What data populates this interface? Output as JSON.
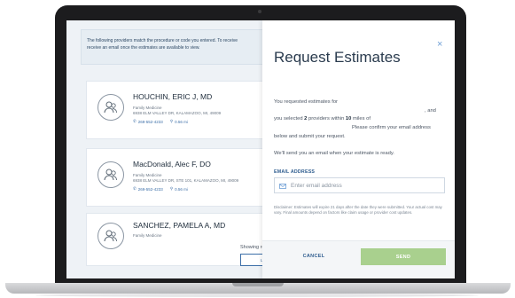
{
  "notice": {
    "line1": "The following providers match the procedure or code you entered. To receive",
    "line2": "receive an email once the estimates are available to view."
  },
  "providers": [
    {
      "name": "HOUCHIN, ERIC J, MD",
      "specialty": "Family Medicine",
      "address": "6938 ELM VALLEY DR, KALAMAZOO, MI, 49009",
      "phone": "269-552-4233",
      "distance": "0.56 mi"
    },
    {
      "name": "MacDonald, Alec F, DO",
      "specialty": "Family Medicine",
      "address": "6938 ELM VALLEY DR, STE 101, KALAMAZOO, MI, 49009",
      "phone": "269-552-4233",
      "distance": "0.56 mi"
    },
    {
      "name": "SANCHEZ, PAMELA A, MD",
      "specialty": "Family Medicine",
      "address": "",
      "phone": "",
      "distance": ""
    }
  ],
  "results_footer": {
    "showing": "Showing result",
    "load_more": "LOAD M"
  },
  "modal": {
    "title": "Request Estimates",
    "close": "×",
    "line1": "You requested estimates for",
    "line1_end": ", and",
    "line2_prefix": "you selected ",
    "line2_count": "2",
    "line2_mid": " providers within ",
    "line2_miles": "10",
    "line2_suffix": " miles of",
    "line3": "Please confirm your email address",
    "line4": "below and submit your request.",
    "line5": "We'll send you an email when your estimate is ready.",
    "email_label": "EMAIL ADDRESS",
    "email_placeholder": "Enter email address",
    "email_value": "",
    "disclaimer": "Disclaimer: Estimates will expire 21 days after the date they were submitted. Your actual cost may vary. Final amounts depend on factors like claim usage or provider cost updates.",
    "cancel": "CANCEL",
    "send": "SEND"
  },
  "icons": {
    "phone": "phone-icon",
    "location": "location-pin-icon",
    "email": "envelope-icon",
    "close": "close-icon",
    "avatar": "user-group-icon"
  },
  "colors": {
    "accent": "#3d6fa8",
    "send_button": "#a9d08e",
    "title": "#2a3b4e"
  }
}
